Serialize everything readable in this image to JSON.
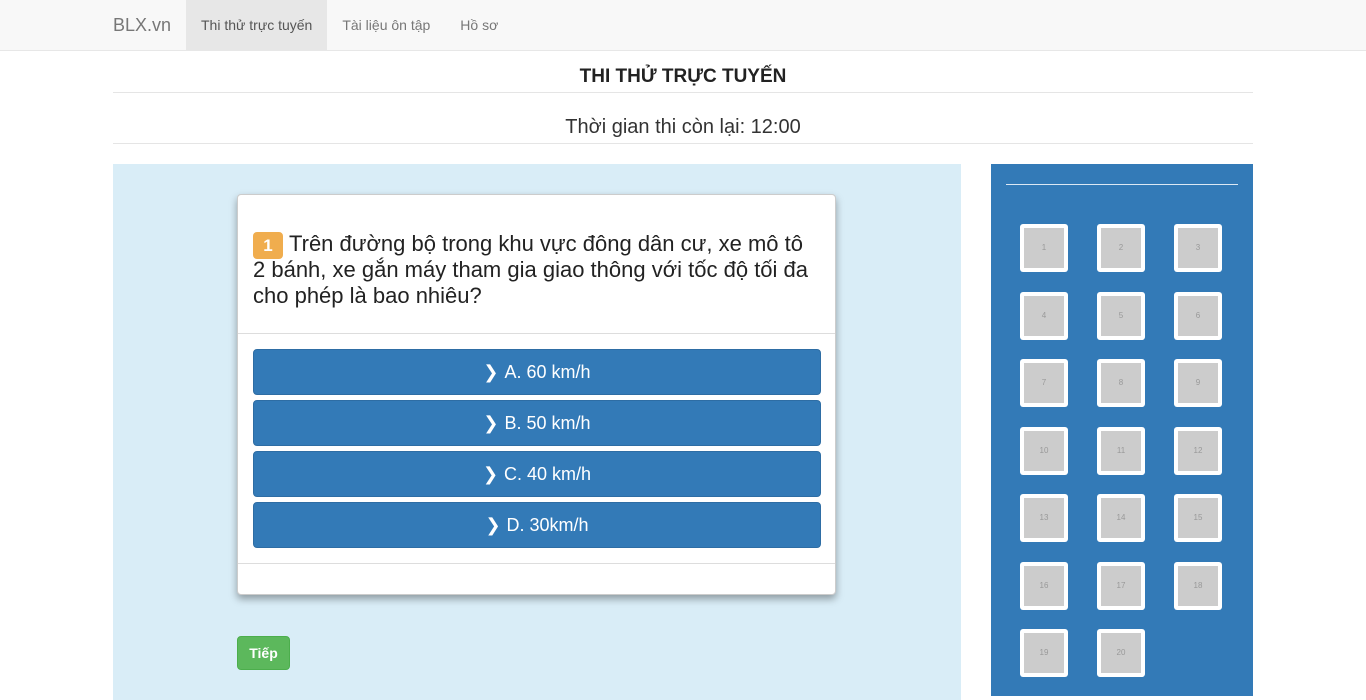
{
  "navbar": {
    "brand": "BLX.vn",
    "items": [
      {
        "label": "Thi thử trực tuyến",
        "active": true
      },
      {
        "label": "Tài liệu ôn tập",
        "active": false
      },
      {
        "label": "Hồ sơ",
        "active": false
      }
    ]
  },
  "page": {
    "title": "THI THỬ TRỰC TUYẾN",
    "timer": "Thời gian thi còn lại: 12:00"
  },
  "question": {
    "number": "1",
    "text": "Trên đường bộ trong khu vực đông dân cư, xe mô tô 2 bánh, xe gắn máy tham gia giao thông với tốc độ tối đa cho phép là bao nhiêu?",
    "answers": [
      {
        "label": "A. 60 km/h"
      },
      {
        "label": "B. 50 km/h"
      },
      {
        "label": "C. 40 km/h"
      },
      {
        "label": "D. 30km/h"
      }
    ]
  },
  "next_button": "Tiếp",
  "question_grid": [
    "1",
    "2",
    "3",
    "4",
    "5",
    "6",
    "7",
    "8",
    "9",
    "10",
    "11",
    "12",
    "13",
    "14",
    "15",
    "16",
    "17",
    "18",
    "19",
    "20"
  ],
  "colors": {
    "primary": "#337ab7",
    "success": "#5cb85c",
    "warning": "#f0ad4e",
    "main_bg": "#d9edf7"
  },
  "icons": {
    "answer_icon": "chevron-right-icon"
  }
}
